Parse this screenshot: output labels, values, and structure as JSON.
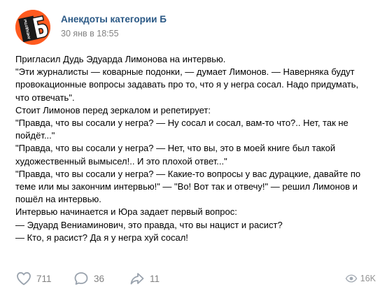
{
  "post": {
    "group_name": "Анекдоты категории Б",
    "date": "30 янв в 18:55",
    "avatar_logo_text": "АНЕКДОТЫ",
    "avatar_logo_letter": "Б",
    "text_lines": [
      "Пригласил Дудь Эдуарда Лимонова на интервью.",
      "\"Эти журналисты — коварные подонки, — думает Лимонов. — Наверняка будут",
      "провокационные вопросы задавать про то, что я у негра сосал. Надо придумать,",
      "что отвечать\".",
      "Стоит Лимонов перед зеркалом и репетирует:",
      "\"Правда, что вы сосали у негра? — Ну сосал и сосал, вам-то что?.. Нет, так не",
      "пойдёт...\"",
      "\"Правда, что вы сосали у негра? — Нет, что вы, это в моей книге был такой",
      "художественный вымысел!.. И это плохой ответ...\"",
      "\"Правда, что вы сосали у негра? — Какие-то вопросы у вас дурацкие, давайте по",
      "теме или мы закончим интервью!\" — \"Во! Вот так и отвечу!\" — решил Лимонов и",
      "пошёл на интервью.",
      "Интервью начинается и Юра задает первый вопрос:",
      "— Эдуард Вениаминович, это правда, что вы нацист и расист?",
      "— Кто, я расист? Да я у негра хуй сосал!"
    ]
  },
  "actions": {
    "likes": "711",
    "comments": "36",
    "shares": "11",
    "views": "16K"
  },
  "icons": {
    "like": "heart-icon",
    "comment": "comment-icon",
    "share": "share-icon",
    "views": "eye-icon"
  },
  "colors": {
    "link": "#2a5885",
    "secondary_text": "#828282",
    "avatar_bg": "#ff5a1f"
  }
}
